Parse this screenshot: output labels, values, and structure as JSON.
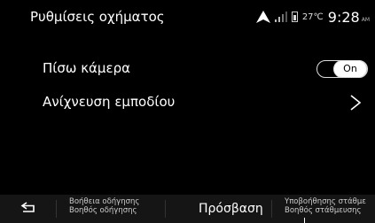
{
  "header": {
    "title": "Ρυθμίσεις οχήματος",
    "status": {
      "nav_icon": "navigation-arrow-icon",
      "signal_icon": "signal-bars-icon",
      "battery_icon": "phone-battery-icon",
      "temperature": "27℃",
      "time": "9:28",
      "ampm": "AM"
    }
  },
  "settings": {
    "items": [
      {
        "label": "Πίσω κάμερα",
        "control": "toggle",
        "value": "On"
      },
      {
        "label": "Ανίχνευση εμποδίου",
        "control": "chevron-right-icon"
      }
    ]
  },
  "bottom_bar": {
    "back_icon": "back-arrow-icon",
    "shortcut1": {
      "line1": "Βοήθεια οδήγησης",
      "line2": "Βοηθός οδήγησης"
    },
    "access_label": "Πρόσβαση",
    "shortcut2": {
      "line1": "Υποβοήθησης στάθμε",
      "line2": "Βοηθός στάθμευσης"
    }
  }
}
